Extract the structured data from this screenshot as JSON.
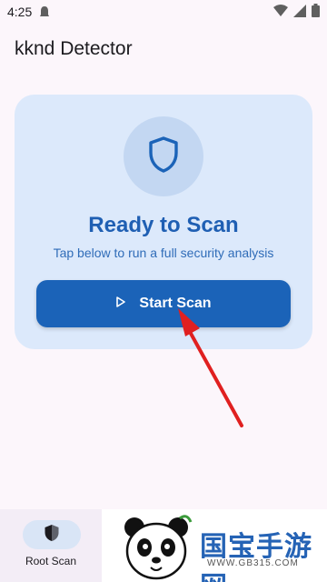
{
  "status_bar": {
    "time": "4:25"
  },
  "app": {
    "title": "kknd Detector"
  },
  "card": {
    "heading": "Ready to Scan",
    "subtitle": "Tap below to run a full security analysis",
    "start_button": "Start Scan"
  },
  "bottom_nav": {
    "items": [
      {
        "label": "Root Scan",
        "icon": "shield-icon",
        "selected": true
      }
    ]
  },
  "watermark": {
    "text": "国宝手游网",
    "url": "WWW.GB315.COM"
  },
  "colors": {
    "accent": "#1b63b8",
    "card_bg": "#dce9fb",
    "heading": "#1f5fb3",
    "annotation_arrow": "#e02020"
  }
}
